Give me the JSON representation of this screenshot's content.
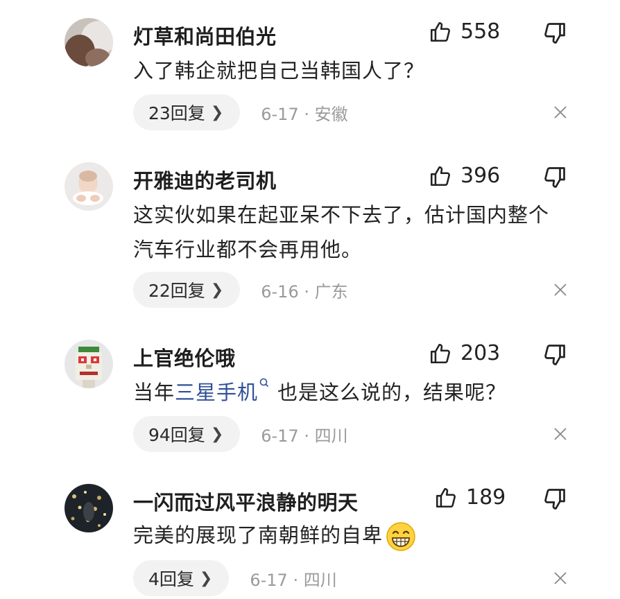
{
  "comments": [
    {
      "username": "灯草和尚田伯光",
      "likes": "558",
      "text": "入了韩企就把自己当韩国人了？",
      "replies": "23回复",
      "date_location": "6-17 · 安徽"
    },
    {
      "username": "开雅迪的老司机",
      "likes": "396",
      "text_line1": "这实伙如果在起亚呆不下去了，估计国内整个",
      "text_line2": "汽车行业都不会再用他。",
      "replies": "22回复",
      "date_location": "6-16 · 广东"
    },
    {
      "username": "上官绝伦哦",
      "likes": "203",
      "text_before": "当年",
      "text_link": "三星手机",
      "text_after": "也是这么说的，结果呢？",
      "replies": "94回复",
      "date_location": "6-17 · 四川"
    },
    {
      "username": "一闪而过风平浪静的明天",
      "likes": "189",
      "text": "完美的展现了南朝鲜的自卑",
      "replies": "4回复",
      "date_location": "6-17 · 四川"
    }
  ],
  "icons": {
    "like": "thumbs-up-icon",
    "dislike": "thumbs-down-icon",
    "close": "close-icon",
    "chevron": "chevron-right-icon",
    "search": "search-icon",
    "emoji": "grin-emoji-icon"
  },
  "colors": {
    "link": "#2f4f99",
    "meta_text": "#9a9a9a",
    "pill_bg": "#f2f2f2"
  }
}
